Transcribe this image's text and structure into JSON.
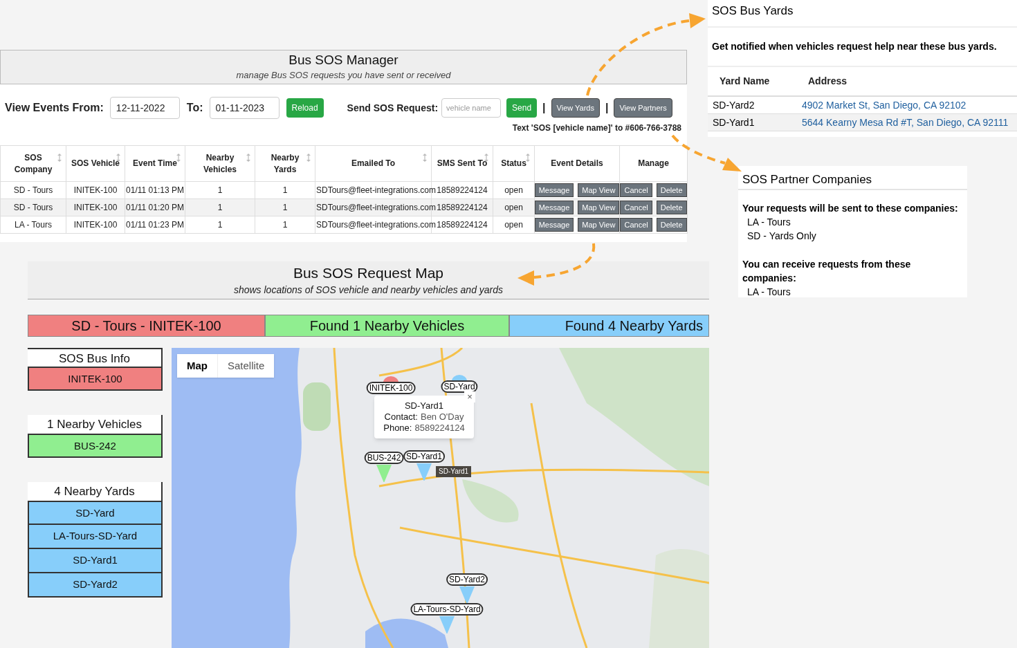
{
  "manager": {
    "title": "Bus SOS Manager",
    "subtitle": "manage Bus SOS requests you have sent or received",
    "from_label": "View Events From:",
    "from_value": "12-11-2022",
    "to_label": "To:",
    "to_value": "01-11-2023",
    "reload": "Reload",
    "send_label": "Send SOS Request:",
    "vehicle_placeholder": "vehicle name",
    "send": "Send",
    "separators": [
      "|",
      "|"
    ],
    "view_yards": "View Yards",
    "view_partners": "View Partners",
    "hint": "Text 'SOS [vehicle name]' to #606-766-3788",
    "table": {
      "columns": [
        {
          "label": "SOS Company",
          "sortable": true
        },
        {
          "label": "SOS Vehicle",
          "sortable": true
        },
        {
          "label": "Event Time",
          "sortable": true
        },
        {
          "label": "Nearby Vehicles",
          "sortable": true
        },
        {
          "label": "Nearby Yards",
          "sortable": true
        },
        {
          "label": "Emailed To",
          "sortable": true
        },
        {
          "label": "SMS Sent To",
          "sortable": true
        },
        {
          "label": "Status",
          "sortable": true
        },
        {
          "label": "Event Details",
          "sortable": false
        },
        {
          "label": "Manage",
          "sortable": false
        }
      ],
      "rows": [
        {
          "cells": [
            "SD - Tours",
            "INITEK-100",
            "01/11 01:13 PM",
            "1",
            "1",
            "SDTours@fleet-integrations.com",
            "18589224124",
            "open"
          ],
          "actions": [
            "Message",
            "Map View",
            "Cancel",
            "Delete"
          ]
        },
        {
          "cells": [
            "SD - Tours",
            "INITEK-100",
            "01/11 01:20 PM",
            "1",
            "1",
            "SDTours@fleet-integrations.com",
            "18589224124",
            "open"
          ],
          "actions": [
            "Message",
            "Map View",
            "Cancel",
            "Delete"
          ]
        },
        {
          "cells": [
            "LA - Tours",
            "INITEK-100",
            "01/11 01:23 PM",
            "1",
            "1",
            "SDTours@fleet-integrations.com",
            "18589224124",
            "open"
          ],
          "actions": [
            "Message",
            "Map View",
            "Cancel",
            "Delete"
          ]
        }
      ]
    }
  },
  "map_panel": {
    "title": "Bus SOS Request Map",
    "subtitle": "shows locations of SOS vehicle and nearby vehicles and yards",
    "banners": [
      {
        "label": "SD - Tours - INITEK-100",
        "color": "#f08080"
      },
      {
        "label": "Found 1 Nearby Vehicles",
        "color": "#90ee90"
      },
      {
        "label": "Found 4 Nearby Yards",
        "color": "#87cefa"
      }
    ],
    "sidebar": [
      {
        "heading": "SOS Bus Info",
        "color": "#f08080",
        "items": [
          "INITEK-100"
        ]
      },
      {
        "heading": "1 Nearby Vehicles",
        "color": "#90ee90",
        "items": [
          "BUS-242"
        ]
      },
      {
        "heading": "4 Nearby Yards",
        "color": "#87cefa",
        "items": [
          "SD-Yard",
          "LA-Tours-SD-Yard",
          "SD-Yard1",
          "SD-Yard2"
        ]
      }
    ],
    "map": {
      "type_buttons": [
        {
          "label": "Map",
          "selected": true
        },
        {
          "label": "Satellite",
          "selected": false
        }
      ],
      "markers": [
        {
          "label": "INITEK-100",
          "color": "#f08080"
        },
        {
          "label": "SD-Yard",
          "color": "#87cefa"
        },
        {
          "label": "BUS-242",
          "color": "#90ee90"
        },
        {
          "label": "SD-Yard1",
          "color": "#87cefa"
        },
        {
          "label": "SD-Yard2",
          "color": "#87cefa"
        },
        {
          "label": "LA-Tours-SD-Yard",
          "color": "#87cefa"
        }
      ],
      "popup": {
        "title": "SD-Yard1",
        "contact_label": "Contact:",
        "contact_value": "Ben O'Day",
        "phone_label": "Phone:",
        "phone_value": "8589224124",
        "close": "×"
      },
      "tooltip": "SD-Yard1"
    }
  },
  "yards": {
    "title": "SOS Bus Yards",
    "description": "Get notified when vehicles request help near these bus yards.",
    "columns": [
      "Yard Name",
      "Address"
    ],
    "rows": [
      {
        "name": "SD-Yard2",
        "address": "4902 Market St, San Diego, CA 92102"
      },
      {
        "name": "SD-Yard1",
        "address": "5644 Kearny Mesa Rd #T, San Diego, CA 92111"
      }
    ]
  },
  "partners": {
    "title": "SOS Partner Companies",
    "sent_heading": "Your requests will be sent to these companies:",
    "sent": [
      "LA - Tours",
      "SD - Yards Only"
    ],
    "receive_heading": "You can receive requests from these companies:",
    "receive": [
      "LA - Tours"
    ]
  }
}
